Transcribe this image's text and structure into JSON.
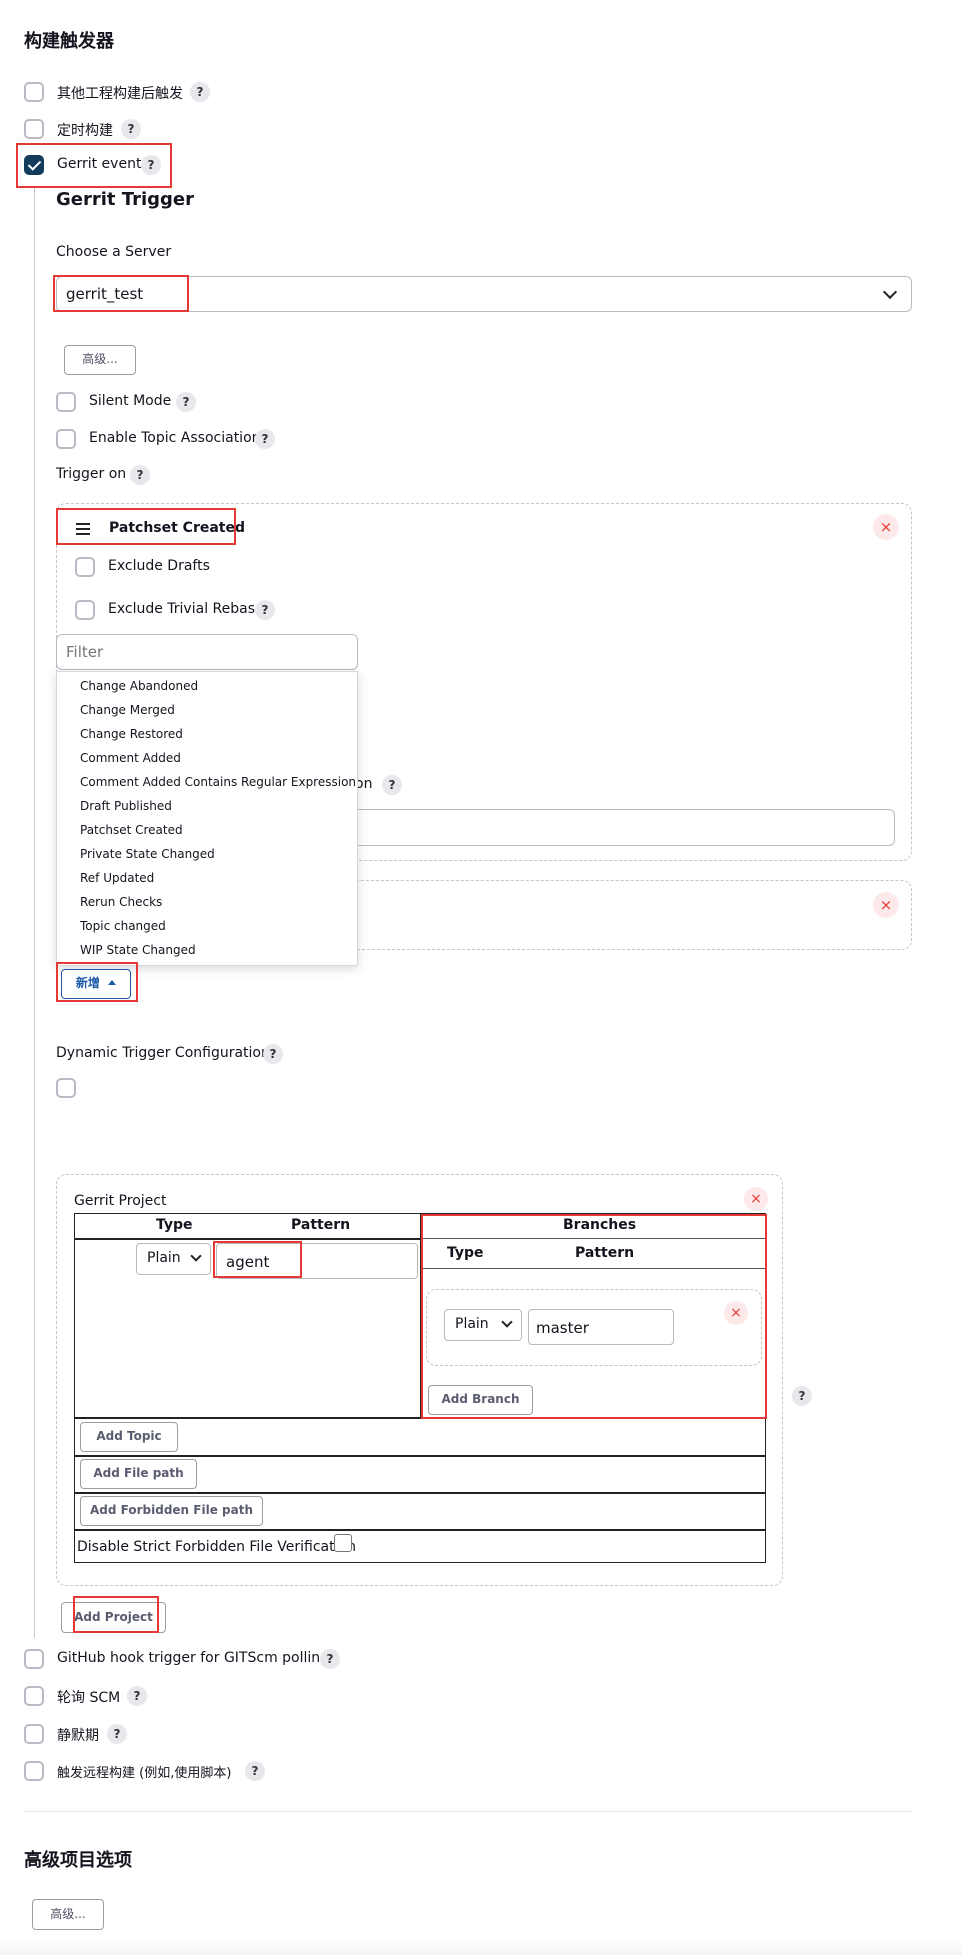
{
  "build_triggers": {
    "title": "构建触发器",
    "items_top": [
      {
        "label": "其他工程构建后触发",
        "checked": false
      },
      {
        "label": "定时构建",
        "checked": false
      },
      {
        "label": "Gerrit event",
        "checked": true
      }
    ],
    "items_bottom": [
      {
        "label": "GitHub hook trigger for GITScm polling",
        "checked": false
      },
      {
        "label": "轮询 SCM",
        "checked": false
      },
      {
        "label": "静默期",
        "checked": false
      },
      {
        "label": "触发远程构建 (例如,使用脚本)",
        "checked": false
      }
    ],
    "help_glyph": "?"
  },
  "gerrit_trigger": {
    "title": "Gerrit Trigger",
    "choose_server_label": "Choose a Server",
    "server_value": "gerrit_test",
    "advanced_label": "高级...",
    "silent_mode_label": "Silent Mode",
    "topic_association_label": "Enable Topic Association",
    "trigger_on_label": "Trigger on",
    "patchset_created": {
      "title": "Patchset Created",
      "exclude_drafts_label": "Exclude Drafts",
      "exclude_trivial_rebase_label": "Exclude Trivial Rebase",
      "partial_label_fragment": "on"
    },
    "filter_placeholder": "Filter",
    "dropdown_items": [
      "Change Abandoned",
      "Change Merged",
      "Change Restored",
      "Comment Added",
      "Comment Added Contains Regular Expression",
      "Draft Published",
      "Patchset Created",
      "Private State Changed",
      "Ref Updated",
      "Rerun Checks",
      "Topic changed",
      "WIP State Changed"
    ],
    "add_label": "新增",
    "remove_glyph": "×",
    "dynamic_trigger_label": "Dynamic Trigger Configuration",
    "gerrit_project": {
      "title": "Gerrit Project",
      "col_type": "Type",
      "col_pattern": "Pattern",
      "col_branches": "Branches",
      "project_type": "Plain",
      "project_pattern": "agent",
      "branch_type": "Plain",
      "branch_pattern": "master",
      "add_branch_label": "Add Branch",
      "add_topic_label": "Add Topic",
      "add_file_path_label": "Add File path",
      "add_forbidden_label": "Add Forbidden File path",
      "disable_strict_label": "Disable Strict Forbidden File Verification"
    },
    "add_project_label": "Add Project"
  },
  "advanced_project_options": {
    "title": "高级项目选项",
    "advanced_label": "高级..."
  }
}
